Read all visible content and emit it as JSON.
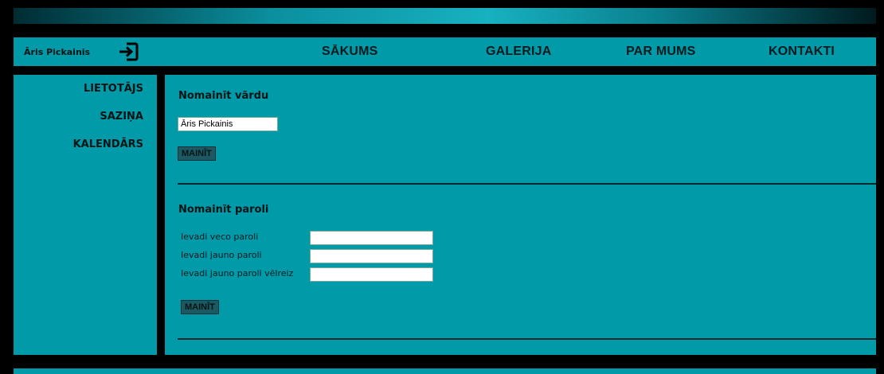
{
  "header": {
    "user_name": "Āris Pickainis",
    "logout_icon": "logout-icon"
  },
  "nav": {
    "items": [
      {
        "label": "SĀKUMS"
      },
      {
        "label": "GALERIJA"
      },
      {
        "label": "PAR MUMS"
      },
      {
        "label": "KONTAKTI"
      }
    ]
  },
  "sidebar": {
    "items": [
      {
        "label": "LIETOTĀJS"
      },
      {
        "label": "SAZIŅA"
      },
      {
        "label": "KALENDĀRS"
      }
    ]
  },
  "change_name": {
    "title": "Nomainīt vārdu",
    "input_value": "Āris Pickainis",
    "button_label": "MAINĪT"
  },
  "change_password": {
    "title": "Nomainīt paroli",
    "fields": [
      {
        "label": "Ievadi veco paroli",
        "value": ""
      },
      {
        "label": "Ievadi jauno paroli",
        "value": ""
      },
      {
        "label": "Ievadi jauno paroli vēlreiz",
        "value": ""
      }
    ],
    "button_label": "MAINĪT"
  },
  "colors": {
    "panel": "#009aa8",
    "background": "#000000",
    "button": "#1c5963",
    "text": "#001414"
  }
}
